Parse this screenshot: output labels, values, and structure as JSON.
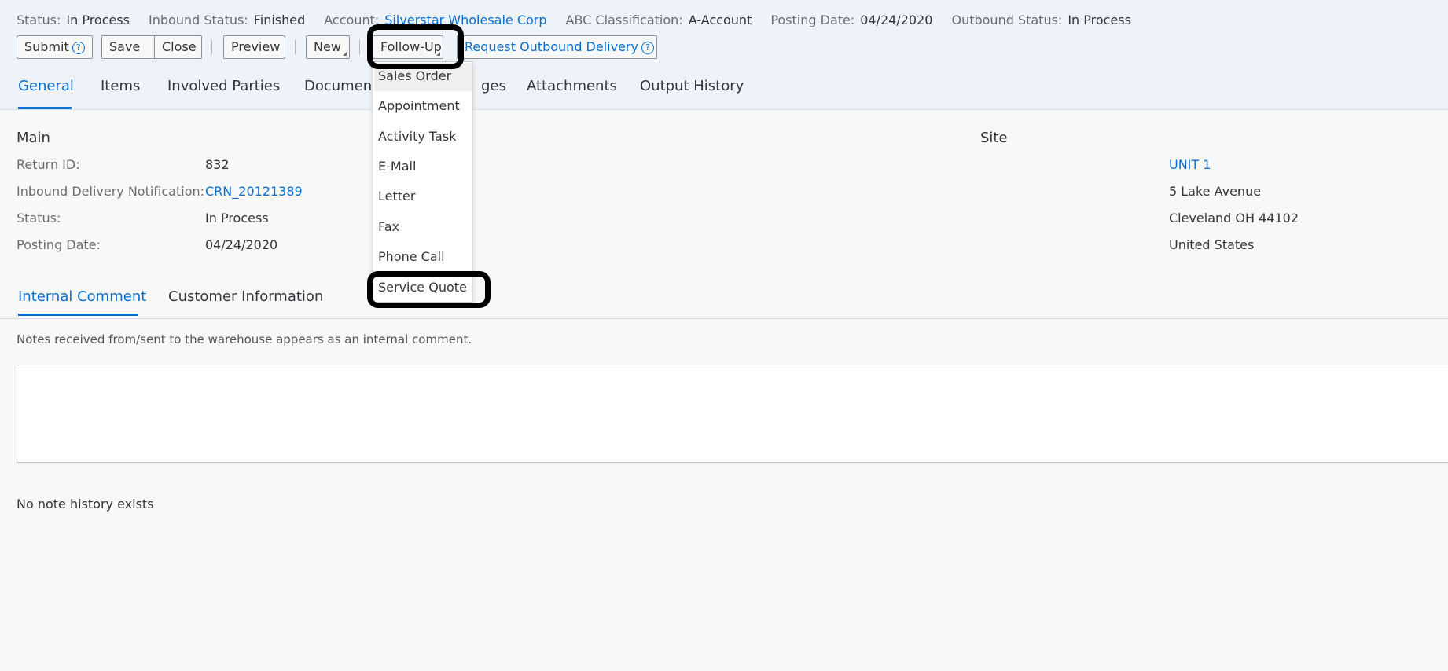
{
  "status_bar": {
    "fields": [
      {
        "label": "Status:",
        "value": "In Process",
        "link": false
      },
      {
        "label": "Inbound Status:",
        "value": "Finished",
        "link": false
      },
      {
        "label": "Account:",
        "value": "Silverstar Wholesale Corp",
        "link": true
      },
      {
        "label": "ABC Classification:",
        "value": "A-Account",
        "link": false
      },
      {
        "label": "Posting Date:",
        "value": "04/24/2020",
        "link": false
      },
      {
        "label": "Outbound Status:",
        "value": "In Process",
        "link": false
      }
    ]
  },
  "toolbar": {
    "submit": "Submit",
    "help_glyph": "?",
    "save": "Save",
    "close": "Close",
    "preview": "Preview",
    "new": "New",
    "follow_up": "Follow-Up",
    "request_outbound": "Request Outbound Delivery"
  },
  "tabs": [
    "General",
    "Items",
    "Involved Parties",
    "Documen",
    "ges",
    "Attachments",
    "Output History"
  ],
  "main": {
    "title": "Main",
    "fields": [
      {
        "label": "Return ID:",
        "value": "832",
        "link": false
      },
      {
        "label": "Inbound Delivery Notification:",
        "value": "CRN_20121389",
        "link": true
      },
      {
        "label": "Status:",
        "value": "In Process",
        "link": false
      },
      {
        "label": "Posting Date:",
        "value": "04/24/2020",
        "link": false
      }
    ]
  },
  "site": {
    "title": "Site",
    "lines": [
      "UNIT 1",
      "5 Lake Avenue",
      "Cleveland OH  44102",
      "United States"
    ]
  },
  "subtabs": [
    "Internal Comment",
    "Customer Information"
  ],
  "note_text": "Notes received from/sent to the warehouse appears as an internal comment.",
  "no_history": "No note history exists",
  "follow_up_menu": {
    "items": [
      "Sales Order",
      "Appointment",
      "Activity Task",
      "E-Mail",
      "Letter",
      "Fax",
      "Phone Call",
      "Service Quote"
    ]
  }
}
